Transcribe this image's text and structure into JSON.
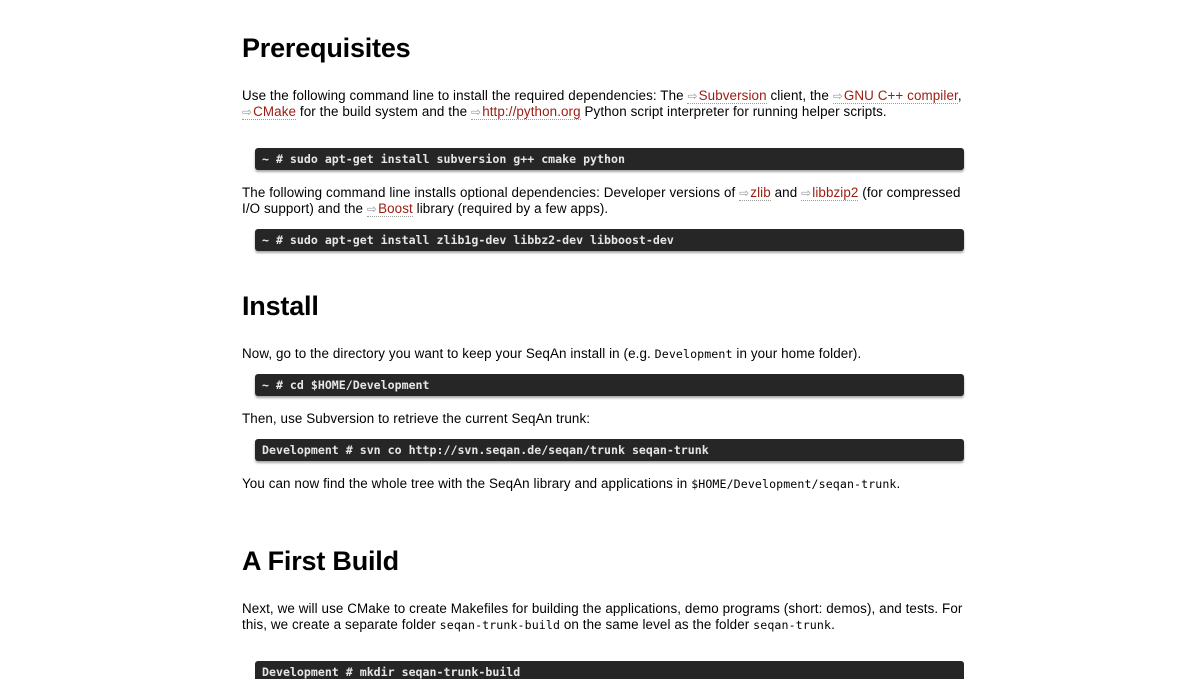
{
  "sections": {
    "prerequisites": {
      "heading": "Prerequisites",
      "intro": {
        "t1": "Use the following command line to install the required dependencies: The ",
        "link_subversion": "Subversion",
        "t2": " client, the ",
        "link_gnu": "GNU C++ compiler",
        "t3": ", ",
        "link_cmake": "CMake",
        "t4": " for the build system and the ",
        "link_python": "http://python.org",
        "t5": " Python script interpreter for running helper scripts."
      },
      "cmd1": "~ # sudo apt-get install subversion g++ cmake python",
      "optional": {
        "t1": "The following command line installs optional dependencies: Developer versions of ",
        "link_zlib": "zlib",
        "t2": " and ",
        "link_libbzip2": "libbzip2",
        "t3": " (for compressed I/O support) and the ",
        "link_boost": "Boost",
        "t4": " library (required by a few apps)."
      },
      "cmd2": "~ # sudo apt-get install zlib1g-dev libbz2-dev libboost-dev"
    },
    "install": {
      "heading": "Install",
      "p1": {
        "t1": "Now, go to the directory you want to keep your SeqAn install in (e.g. ",
        "code": "Development",
        "t2": " in your home folder)."
      },
      "cmd1": "~ # cd $HOME/Development",
      "p2": "Then, use Subversion to retrieve the current SeqAn trunk:",
      "cmd2": "Development # svn co http://svn.seqan.de/seqan/trunk seqan-trunk",
      "p3": {
        "t1": "You can now find the whole tree with the SeqAn library and applications in ",
        "code": "$HOME/Development/seqan-trunk",
        "t2": "."
      }
    },
    "first_build": {
      "heading": "A First Build",
      "p1": {
        "t1": "Next, we will use CMake to create Makefiles for building the applications, demo programs (short: demos), and tests. For this, we create a separate folder ",
        "code1": "seqan-trunk-build",
        "t2": " on the same level as the folder ",
        "code2": "seqan-trunk",
        "t3": "."
      },
      "cmd1": "Development # mkdir seqan-trunk-build"
    }
  },
  "icons": {
    "external_link": "external-link-icon"
  },
  "colors": {
    "link": "#9b1b10",
    "code_bg": "#262626",
    "code_text": "#e6e6e6"
  }
}
